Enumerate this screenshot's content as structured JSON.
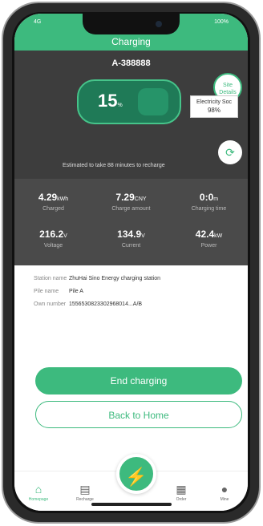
{
  "status_bar": {
    "left": "4G",
    "right": "100%"
  },
  "header": {
    "title": "Charging"
  },
  "pile_id": "A-388888",
  "charge": {
    "percent": "15",
    "unit": "%"
  },
  "site_details": {
    "line1": "Site",
    "line2": "Details"
  },
  "soc": {
    "label": "Electricity Soc",
    "value": "98%"
  },
  "estimate_text": "Estimated to take 88 minutes to recharge",
  "stats": [
    {
      "value": "4.29",
      "unit": "kWh",
      "label": "Charged"
    },
    {
      "value": "7.29",
      "unit": "CNY",
      "label": "Charge amount"
    },
    {
      "value": "0:0",
      "unit": "m",
      "label": "Charging time"
    },
    {
      "value": "216.2",
      "unit": "V",
      "label": "Voltage"
    },
    {
      "value": "134.9",
      "unit": "V",
      "label": "Current"
    },
    {
      "value": "42.4",
      "unit": "kW",
      "label": "Power"
    }
  ],
  "info": {
    "station_label": "Station name",
    "station_value": "ZhuHai Sino Energy charging station",
    "pile_label": "Pile name",
    "pile_value": "Pile A",
    "order_label": "Own number",
    "order_value": "1556530823302968014...A/B"
  },
  "buttons": {
    "end": "End charging",
    "home": "Back to Home"
  },
  "tabs": [
    {
      "icon": "home-icon",
      "label": "Homepage"
    },
    {
      "icon": "pile-icon",
      "label": "Recharge"
    },
    {
      "icon": "order-icon",
      "label": "Order"
    },
    {
      "icon": "user-icon",
      "label": "Mine"
    }
  ],
  "colors": {
    "accent": "#3dba7e",
    "dark": "#3d3d3d"
  }
}
